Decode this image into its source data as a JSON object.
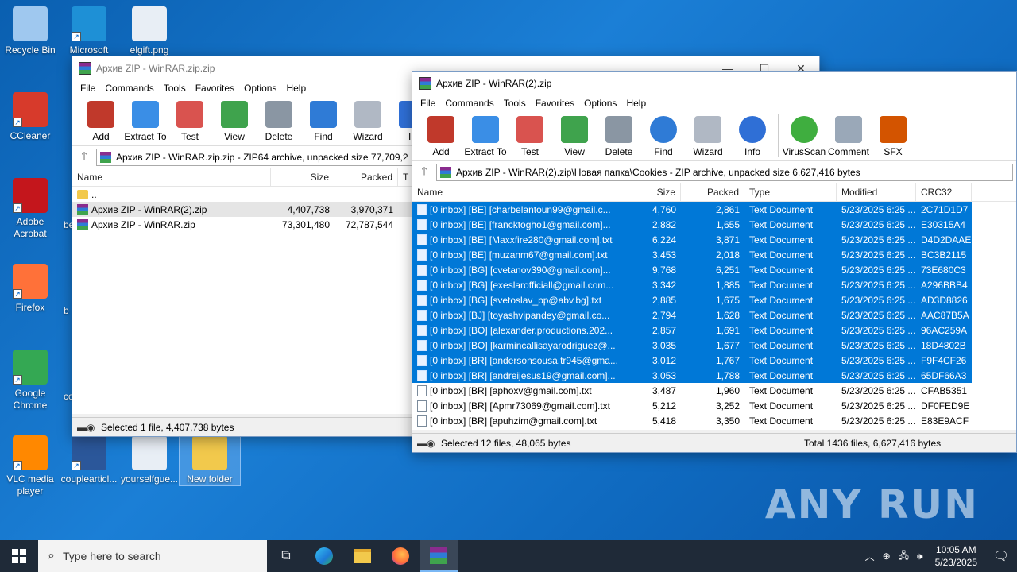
{
  "desktop_icons": [
    {
      "label": "Recycle Bin",
      "color": "#9fc8ef"
    },
    {
      "label": "Microsoft",
      "color": "#1e90d6"
    },
    {
      "label": "elgift.png",
      "color": "#e8eef5"
    },
    {
      "label": "CCleaner",
      "color": "#d73a2b"
    },
    {
      "label": "Adobe Acrobat",
      "color": "#c4161c"
    },
    {
      "label": "Firefox",
      "color": "#ff7139"
    },
    {
      "label": "Google Chrome",
      "color": "#34a853"
    },
    {
      "label": "VLC media player",
      "color": "#ff8800"
    },
    {
      "label": "couplearticl...",
      "color": "#2b579a"
    },
    {
      "label": "yourselfgue...",
      "color": "#e8eef5"
    },
    {
      "label": "New folder",
      "color": "#f2c94c"
    }
  ],
  "partial_labels": [
    "be",
    "b",
    "co"
  ],
  "win1": {
    "title": "Архив ZIP - WinRAR.zip.zip",
    "menu": [
      "File",
      "Commands",
      "Tools",
      "Favorites",
      "Options",
      "Help"
    ],
    "toolbar": [
      "Add",
      "Extract To",
      "Test",
      "View",
      "Delete",
      "Find",
      "Wizard",
      "In"
    ],
    "path": "Архив ZIP - WinRAR.zip.zip - ZIP64 archive, unpacked size 77,709,2",
    "columns": [
      "Name",
      "Size",
      "Packed",
      "T"
    ],
    "rows": [
      {
        "name": "..",
        "size": "",
        "packed": ""
      },
      {
        "name": "Архив ZIP - WinRAR(2).zip",
        "size": "4,407,738",
        "packed": "3,970,371"
      },
      {
        "name": "Архив ZIP - WinRAR.zip",
        "size": "73,301,480",
        "packed": "72,787,544"
      }
    ],
    "status": "Selected 1 file, 4,407,738 bytes"
  },
  "win2": {
    "title": "Архив ZIP - WinRAR(2).zip",
    "menu": [
      "File",
      "Commands",
      "Tools",
      "Favorites",
      "Options",
      "Help"
    ],
    "toolbar": [
      {
        "label": "Add",
        "color": "#c0392b"
      },
      {
        "label": "Extract To",
        "color": "#3a8ee6"
      },
      {
        "label": "Test",
        "color": "#d9534f"
      },
      {
        "label": "View",
        "color": "#3fa34d"
      },
      {
        "label": "Delete",
        "color": "#8a96a3"
      },
      {
        "label": "Find",
        "color": "#2f7bd6"
      },
      {
        "label": "Wizard",
        "color": "#b0b8c4"
      },
      {
        "label": "Info",
        "color": "#2f6fd6"
      },
      {
        "label": "VirusScan",
        "color": "#3fae3f"
      },
      {
        "label": "Comment",
        "color": "#9aa8b8"
      },
      {
        "label": "SFX",
        "color": "#d35400"
      }
    ],
    "path": "Архив ZIP - WinRAR(2).zip\\Новая папка\\Cookies - ZIP archive, unpacked size 6,627,416 bytes",
    "columns": [
      "Name",
      "Size",
      "Packed",
      "Type",
      "Modified",
      "CRC32"
    ],
    "rows": [
      {
        "name": "[0 inbox] [BE] [charbelantoun99@gmail.c...",
        "size": "4,760",
        "packed": "2,861",
        "type": "Text Document",
        "modified": "5/23/2025 6:25 ...",
        "crc": "2C71D1D7",
        "sel": true
      },
      {
        "name": "[0 inbox] [BE] [francktogho1@gmail.com]...",
        "size": "2,882",
        "packed": "1,655",
        "type": "Text Document",
        "modified": "5/23/2025 6:25 ...",
        "crc": "E30315A4",
        "sel": true
      },
      {
        "name": "[0 inbox] [BE] [Maxxfire280@gmail.com].txt",
        "size": "6,224",
        "packed": "3,871",
        "type": "Text Document",
        "modified": "5/23/2025 6:25 ...",
        "crc": "D4D2DAAE",
        "sel": true
      },
      {
        "name": "[0 inbox] [BE] [muzanm67@gmail.com].txt",
        "size": "3,453",
        "packed": "2,018",
        "type": "Text Document",
        "modified": "5/23/2025 6:25 ...",
        "crc": "BC3B2115",
        "sel": true
      },
      {
        "name": "[0 inbox] [BG] [cvetanov390@gmail.com]...",
        "size": "9,768",
        "packed": "6,251",
        "type": "Text Document",
        "modified": "5/23/2025 6:25 ...",
        "crc": "73E680C3",
        "sel": true
      },
      {
        "name": "[0 inbox] [BG] [exeslarofficiall@gmail.com...",
        "size": "3,342",
        "packed": "1,885",
        "type": "Text Document",
        "modified": "5/23/2025 6:25 ...",
        "crc": "A296BBB4",
        "sel": true
      },
      {
        "name": "[0 inbox] [BG] [svetoslav_pp@abv.bg].txt",
        "size": "2,885",
        "packed": "1,675",
        "type": "Text Document",
        "modified": "5/23/2025 6:25 ...",
        "crc": "AD3D8826",
        "sel": true
      },
      {
        "name": "[0 inbox] [BJ] [toyashvipandey@gmail.co...",
        "size": "2,794",
        "packed": "1,628",
        "type": "Text Document",
        "modified": "5/23/2025 6:25 ...",
        "crc": "AAC87B5A",
        "sel": true
      },
      {
        "name": "[0 inbox] [BO] [alexander.productions.202...",
        "size": "2,857",
        "packed": "1,691",
        "type": "Text Document",
        "modified": "5/23/2025 6:25 ...",
        "crc": "96AC259A",
        "sel": true
      },
      {
        "name": "[0 inbox] [BO] [karmincallisayarodriguez@...",
        "size": "3,035",
        "packed": "1,677",
        "type": "Text Document",
        "modified": "5/23/2025 6:25 ...",
        "crc": "18D4802B",
        "sel": true
      },
      {
        "name": "[0 inbox] [BR] [andersonsousa.tr945@gma...",
        "size": "3,012",
        "packed": "1,767",
        "type": "Text Document",
        "modified": "5/23/2025 6:25 ...",
        "crc": "F9F4CF26",
        "sel": true
      },
      {
        "name": "[0 inbox] [BR] [andreijesus19@gmail.com]...",
        "size": "3,053",
        "packed": "1,788",
        "type": "Text Document",
        "modified": "5/23/2025 6:25 ...",
        "crc": "65DF66A3",
        "sel": true
      },
      {
        "name": "[0 inbox] [BR] [aphoxv@gmail.com].txt",
        "size": "3,487",
        "packed": "1,960",
        "type": "Text Document",
        "modified": "5/23/2025 6:25 ...",
        "crc": "CFAB5351",
        "sel": false
      },
      {
        "name": "[0 inbox] [BR] [Apmr73069@gmail.com].txt",
        "size": "5,212",
        "packed": "3,252",
        "type": "Text Document",
        "modified": "5/23/2025 6:25 ...",
        "crc": "DF0FED9E",
        "sel": false
      },
      {
        "name": "[0 inbox] [BR] [apuhzim@gmail.com].txt",
        "size": "5,418",
        "packed": "3,350",
        "type": "Text Document",
        "modified": "5/23/2025 6:25 ...",
        "crc": "E83E9ACF",
        "sel": false
      }
    ],
    "status_left": "Selected 12 files, 48,065 bytes",
    "status_right": "Total 1436 files, 6,627,416 bytes"
  },
  "taskbar": {
    "search_placeholder": "Type here to search",
    "time": "10:05 AM",
    "date": "5/23/2025",
    "apps": [
      "task-view-icon",
      "edge-icon",
      "file-explorer-icon",
      "firefox-icon",
      "winrar-icon"
    ]
  },
  "watermark": "ANY RUN"
}
